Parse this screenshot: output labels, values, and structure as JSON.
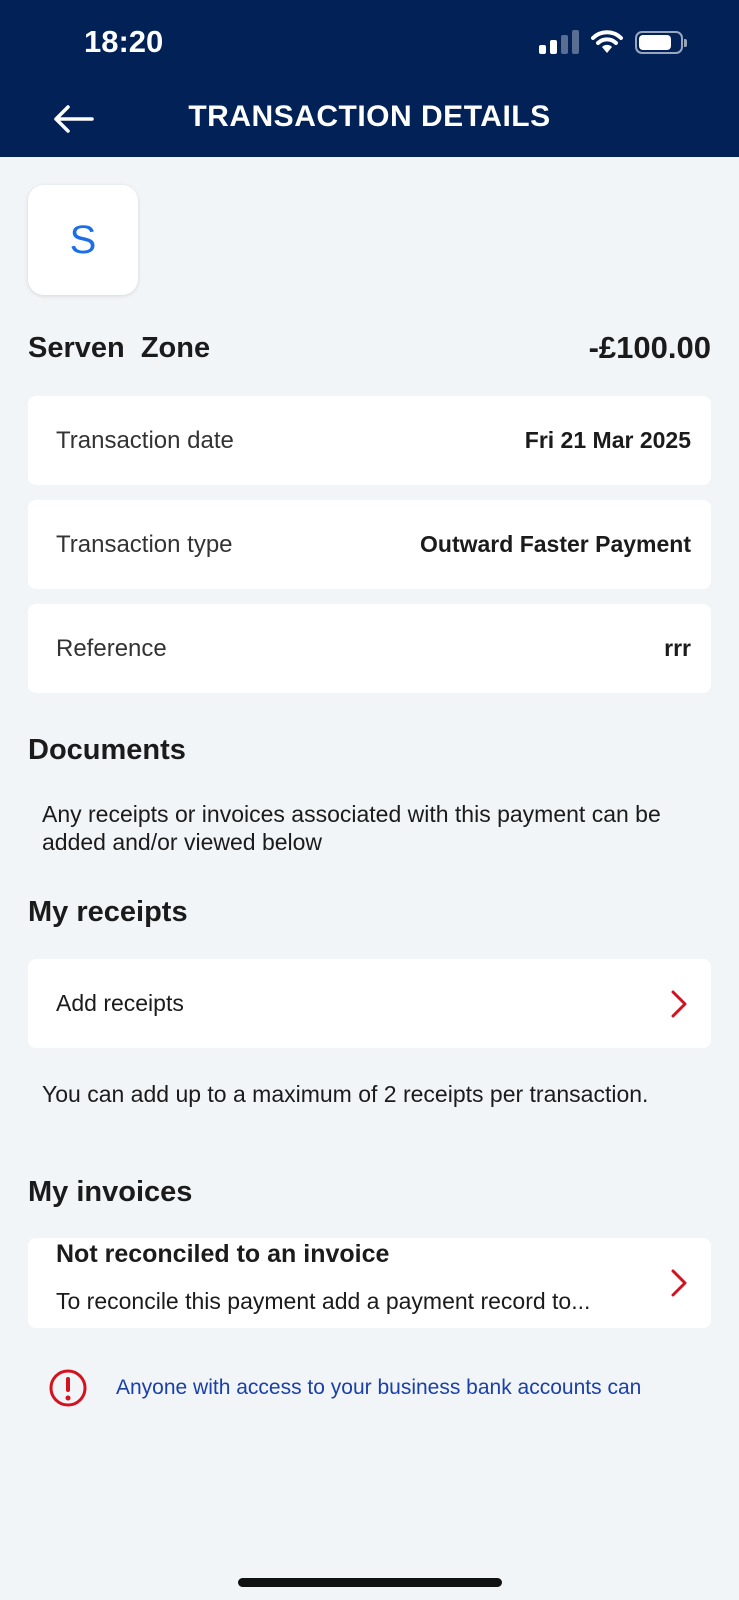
{
  "status_bar": {
    "time": "18:20"
  },
  "header": {
    "title": "TRANSACTION DETAILS",
    "back_icon": "arrow-left-icon"
  },
  "payee": {
    "initial": "S",
    "name": "Serven  Zone",
    "amount": "-£100.00"
  },
  "details": [
    {
      "label": "Transaction date",
      "value": "Fri 21 Mar 2025"
    },
    {
      "label": "Transaction type",
      "value": "Outward Faster Payment"
    },
    {
      "label": "Reference",
      "value": "rrr"
    }
  ],
  "documents": {
    "title": "Documents",
    "description": "Any receipts or invoices associated with this payment can be added and/or viewed below"
  },
  "receipts": {
    "title": "My receipts",
    "add_label": "Add receipts",
    "note": "You can add up to a maximum of 2 receipts per transaction."
  },
  "invoices": {
    "title": "My invoices",
    "status": "Not reconciled to an invoice",
    "hint": "To reconcile this payment add a payment record to..."
  },
  "notice": {
    "text": "Anyone with access to your business bank accounts can"
  },
  "colors": {
    "header_bg": "#012157",
    "accent_red": "#d4121f",
    "link_blue": "#1a3fa8",
    "avatar_blue": "#1b6ee6"
  }
}
